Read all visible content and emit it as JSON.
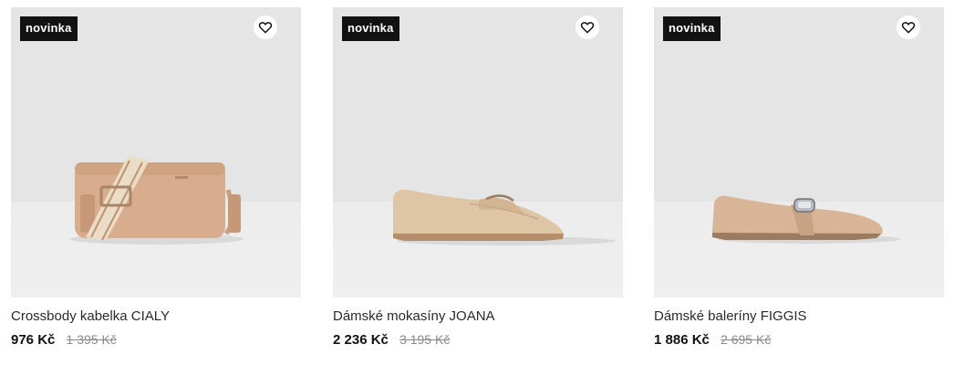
{
  "products": [
    {
      "badge": "novinka",
      "name": "Crossbody kabelka CIALY",
      "price": "976 Kč",
      "old_price": "1 395 Kč",
      "image_icon": "crossbody-bag-image"
    },
    {
      "badge": "novinka",
      "name": "Dámské mokasíny JOANA",
      "price": "2 236 Kč",
      "old_price": "3 195 Kč",
      "image_icon": "loafer-shoe-image"
    },
    {
      "badge": "novinka",
      "name": "Dámské baleríny FIGGIS",
      "price": "1 886 Kč",
      "old_price": "2 695 Kč",
      "image_icon": "ballet-flat-image"
    }
  ],
  "colors": {
    "badge_bg": "#121212",
    "product_tan": "#d2ac8a"
  }
}
